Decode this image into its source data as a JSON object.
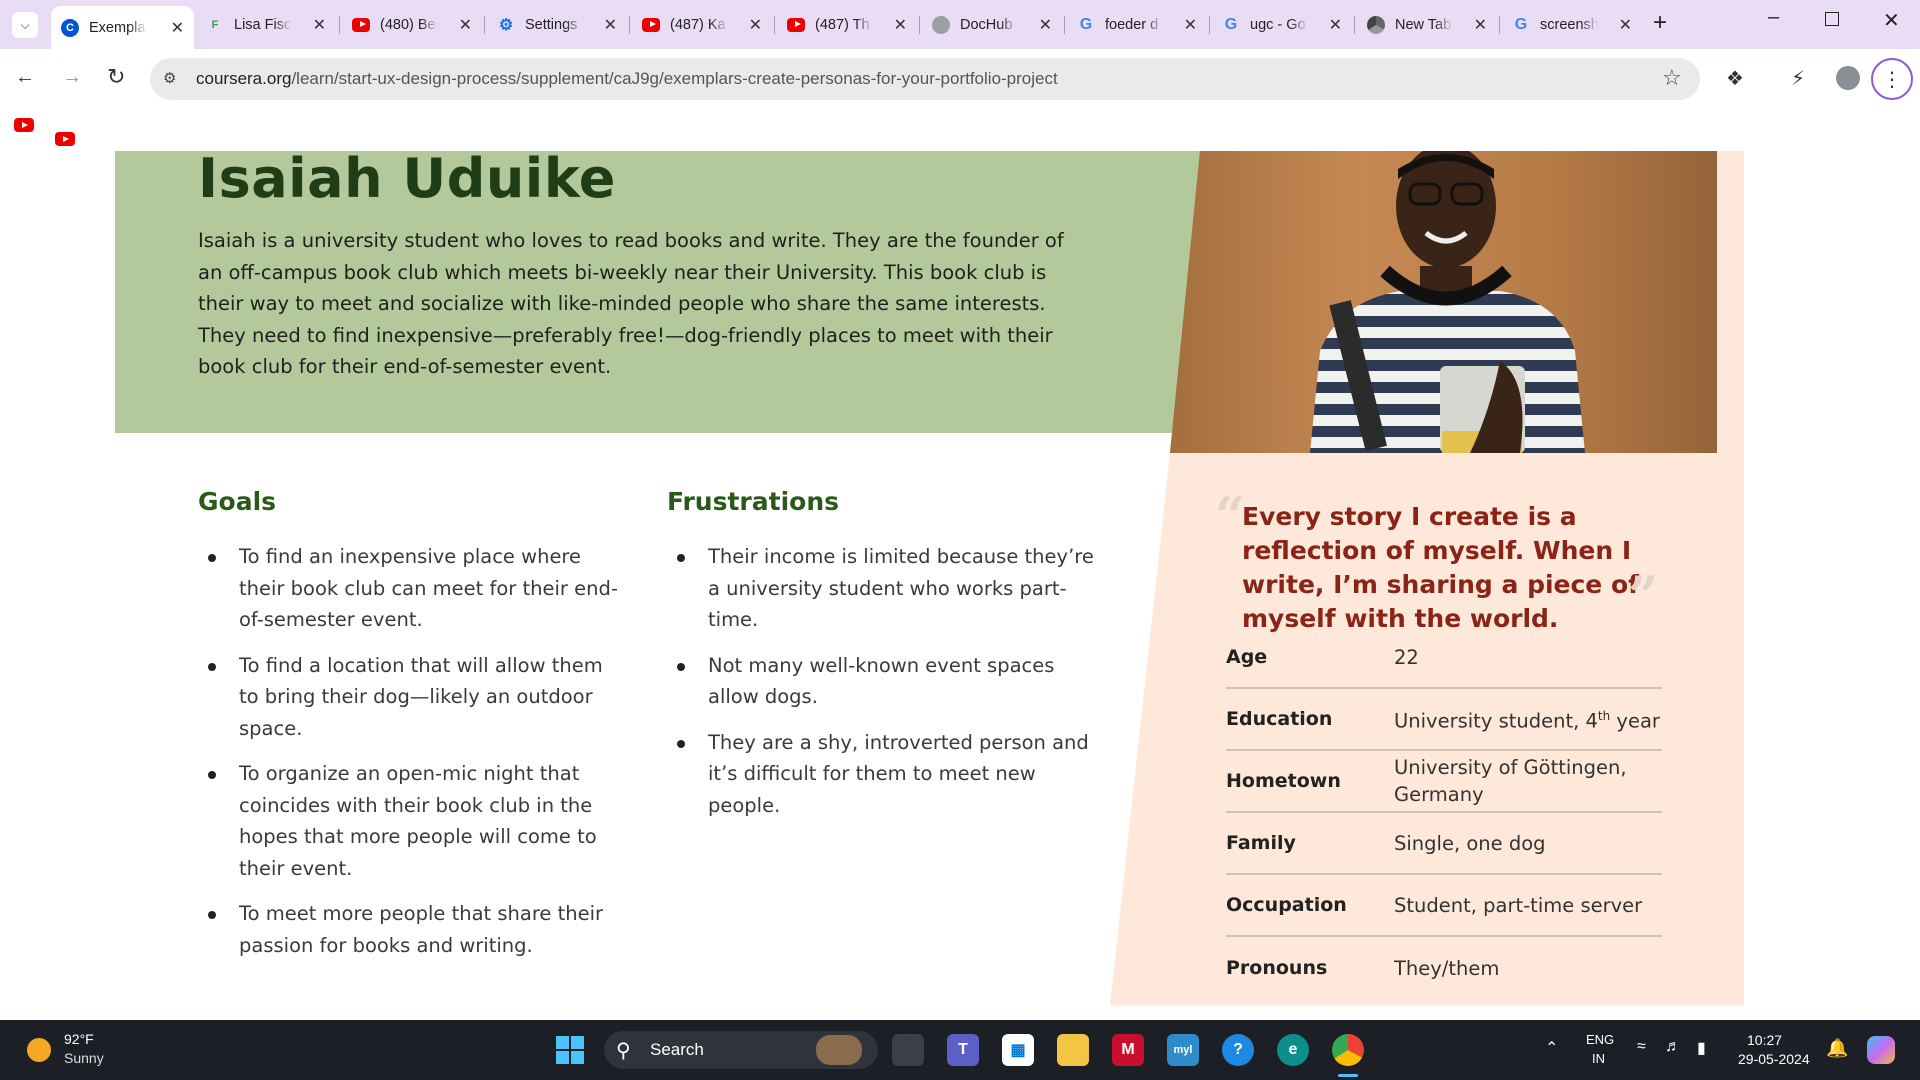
{
  "browser": {
    "tabs": [
      {
        "title": "Exemplars",
        "favicon": "coursera-icon",
        "active": true
      },
      {
        "title": "Lisa Fischer",
        "favicon": "flag-icon"
      },
      {
        "title": "(480) Be",
        "favicon": "youtube-icon"
      },
      {
        "title": "Settings",
        "favicon": "gear-icon"
      },
      {
        "title": "(487) Ka",
        "favicon": "youtube-icon"
      },
      {
        "title": "(487) Th",
        "favicon": "youtube-icon"
      },
      {
        "title": "DocHub",
        "favicon": "globe-icon"
      },
      {
        "title": "foeder d",
        "favicon": "google-icon"
      },
      {
        "title": "ugc - Go",
        "favicon": "google-icon"
      },
      {
        "title": "New Tab",
        "favicon": "chrome-icon"
      },
      {
        "title": "screensh",
        "favicon": "google-icon"
      }
    ],
    "url_host": "coursera.org",
    "url_path": "/learn/start-ux-design-process/supplement/caJ9g/exemplars-create-personas-for-your-portfolio-project",
    "new_tab_label": "+",
    "colors": {
      "tabstrip": "#e9dcf5",
      "omnibox": "#eaeaea"
    }
  },
  "persona": {
    "name": "Isaiah Uduike",
    "intro": [
      "Isaiah is a university student who loves to read books and write. They are the founder of an off-campus book club which meets bi-weekly near their University. This book club is their way to meet and socialize with like-minded people who share the same interests.",
      "They need to find inexpensive—preferably free!—dog-friendly places to meet with their book club for their end-of-semester event."
    ],
    "goals_heading": "Goals",
    "goals": [
      "To find an inexpensive place where their book club can meet for their end-of-semester event.",
      "To find a location that will allow them to bring their dog—likely an outdoor space.",
      "To organize an open-mic night that coincides with their book club in the hopes that more people will come to their event.",
      "To meet more people that share their passion for books and writing."
    ],
    "frustrations_heading": "Frustrations",
    "frustrations": [
      "Their income is limited because they’re a university student who works part-time.",
      "Not many well-known event spaces allow dogs.",
      "They are a shy, introverted person and it’s difficult for them to meet new people."
    ],
    "quote": "Every story I create is a reflection of myself. When I write, I’m sharing a piece of myself with the world.",
    "facts": [
      {
        "label": "Age",
        "value": "22"
      },
      {
        "label": "Education",
        "value": "University student, 4",
        "sup": "th",
        "after": " year"
      },
      {
        "label": "Hometown",
        "value": "University of Göttingen, Germany"
      },
      {
        "label": "Family",
        "value": "Single, one dog"
      },
      {
        "label": "Occupation",
        "value": "Student, part-time server"
      },
      {
        "label": "Pronouns",
        "value": "They/them"
      }
    ],
    "colors": {
      "hero": "#b4c99b",
      "name": "#1f3d16",
      "heading": "#2a5a1a",
      "quote": "#8a2416",
      "panel": "#fde8da"
    }
  },
  "taskbar": {
    "weather_temp": "92°F",
    "weather_desc": "Sunny",
    "search_label": "Search",
    "lang_top": "ENG",
    "lang_bottom": "IN",
    "time": "10:27",
    "date": "29-05-2024"
  }
}
